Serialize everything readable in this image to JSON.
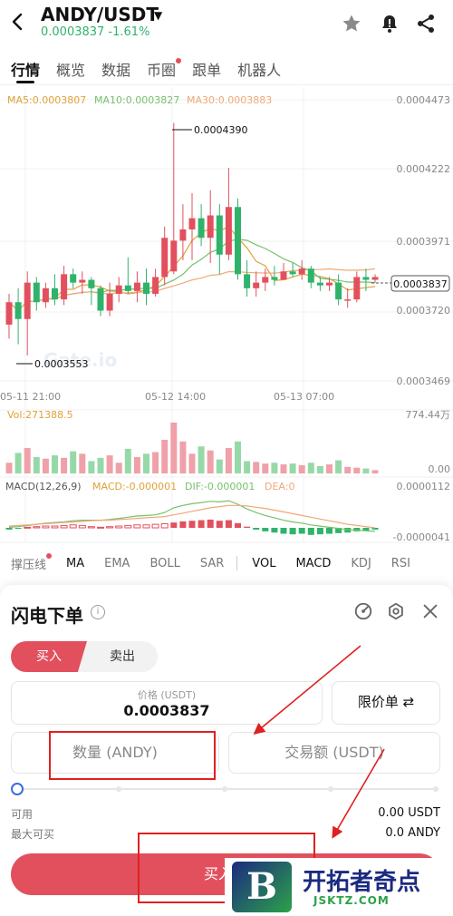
{
  "header": {
    "pair": "ANDY/USDT",
    "price_line": "0.0003837 -1.61%",
    "icons": [
      "back-arrow-icon",
      "caret-down-icon",
      "star-icon",
      "bell-alert-icon",
      "share-icon"
    ]
  },
  "tabs": [
    {
      "label": "行情",
      "active": true
    },
    {
      "label": "概览"
    },
    {
      "label": "数据"
    },
    {
      "label": "币圈",
      "dot": true
    },
    {
      "label": "跟单"
    },
    {
      "label": "机器人"
    }
  ],
  "chart_data": [
    {
      "type": "candlestick",
      "ma_labels": [
        "MA5:0.0003807",
        "MA10:0.0003827",
        "MA30:0.0003883"
      ],
      "ma_colors": [
        "#e0a23a",
        "#76c26b",
        "#f0a878"
      ],
      "y_ticks": [
        "0.0004473",
        "0.0004222",
        "0.0003971",
        "0.0003720",
        "0.0003469"
      ],
      "x_ticks": [
        "05-11 21:00",
        "05-12 14:00",
        "05-13 07:00"
      ],
      "ylim": [
        0.0003469,
        0.0004473
      ],
      "high_label": "0.0004390",
      "low_label": "0.0003553",
      "last_price": "0.0003837",
      "watermark": "Gate.io",
      "candles": [
        [
          0.000367,
          0.000375,
          0.000378,
          0.000362
        ],
        [
          0.000375,
          0.000369,
          0.00038,
          0.00036
        ],
        [
          0.000369,
          0.000382,
          0.000386,
          0.000356
        ],
        [
          0.000382,
          0.000375,
          0.000384,
          0.000372
        ],
        [
          0.000375,
          0.00038,
          0.000382,
          0.000373
        ],
        [
          0.00038,
          0.000376,
          0.000385,
          0.000374
        ],
        [
          0.000376,
          0.000385,
          0.000388,
          0.000374
        ],
        [
          0.000385,
          0.000382,
          0.000387,
          0.00038
        ],
        [
          0.000382,
          0.000383,
          0.000386,
          0.000378
        ],
        [
          0.000383,
          0.00038,
          0.000384,
          0.000374
        ],
        [
          0.00038,
          0.000372,
          0.000381,
          0.00037
        ],
        [
          0.000372,
          0.000378,
          0.000382,
          0.00037
        ],
        [
          0.000378,
          0.000381,
          0.000384,
          0.000375
        ],
        [
          0.000381,
          0.000379,
          0.000391,
          0.000378
        ],
        [
          0.000379,
          0.000382,
          0.000386,
          0.000375
        ],
        [
          0.000382,
          0.000378,
          0.000387,
          0.000374
        ],
        [
          0.000378,
          0.000384,
          0.000387,
          0.000377
        ],
        [
          0.000384,
          0.000398,
          0.000402,
          0.000381
        ],
        [
          0.000386,
          0.000397,
          0.000439,
          0.000385
        ],
        [
          0.000397,
          0.000401,
          0.00041,
          0.00039
        ],
        [
          0.000401,
          0.000405,
          0.000414,
          0.00039
        ],
        [
          0.000405,
          0.000398,
          0.00041,
          0.000395
        ],
        [
          0.000398,
          0.000406,
          0.000415,
          0.000389
        ],
        [
          0.000406,
          0.000392,
          0.00041,
          0.000385
        ],
        [
          0.000392,
          0.000409,
          0.000423,
          0.00039
        ],
        [
          0.000409,
          0.000385,
          0.000412,
          0.000383
        ],
        [
          0.000385,
          0.00038,
          0.00039,
          0.000377
        ],
        [
          0.00038,
          0.000382,
          0.000386,
          0.000377
        ],
        [
          0.000382,
          0.000384,
          0.000387,
          0.000379
        ],
        [
          0.000384,
          0.000383,
          0.000388,
          0.000381
        ],
        [
          0.000383,
          0.000386,
          0.000389,
          0.000383
        ],
        [
          0.000386,
          0.000385,
          0.000389,
          0.000384
        ],
        [
          0.000385,
          0.000387,
          0.00039,
          0.000383
        ],
        [
          0.000387,
          0.000382,
          0.000388,
          0.00038
        ],
        [
          0.000382,
          0.000381,
          0.000384,
          0.000379
        ],
        [
          0.000381,
          0.000382,
          0.000384,
          0.000379
        ],
        [
          0.000382,
          0.000376,
          0.000385,
          0.000374
        ],
        [
          0.000376,
          0.000376,
          0.00038,
          0.000373
        ],
        [
          0.000376,
          0.000384,
          0.000386,
          0.000375
        ],
        [
          0.000384,
          0.000383,
          0.000387,
          0.000379
        ],
        [
          0.000383,
          0.000384,
          0.000385,
          0.000382
        ]
      ]
    },
    {
      "type": "bar",
      "label": "Vol:271388.5",
      "y_ticks": [
        "774.44万",
        "0.00"
      ],
      "ylim": [
        0,
        7744400
      ],
      "values": [
        1300000,
        2500000,
        3100000,
        2000000,
        1800000,
        2200000,
        1900000,
        2700000,
        2400000,
        1500000,
        1900000,
        2200000,
        1300000,
        3000000,
        2000000,
        2400000,
        2600000,
        4100000,
        6200000,
        3900000,
        2400000,
        3300000,
        2800000,
        1700000,
        3100000,
        3900000,
        1500000,
        1400000,
        1200000,
        1300000,
        1100000,
        1200000,
        1000000,
        1300000,
        900000,
        1100000,
        1600000,
        800000,
        700000,
        600000,
        400000
      ]
    },
    {
      "type": "bar",
      "label_parts": [
        "MACD(12,26,9)",
        "MACD:-0.000001",
        "DIF:-0.000001",
        "DEA:0"
      ],
      "y_ticks": [
        "0.0000112",
        "-0.0000041"
      ],
      "ylim": [
        -4.1e-06,
        1.12e-05
      ],
      "values": [
        -0.3,
        -0.1,
        0.1,
        0.2,
        0.3,
        0.3,
        0.4,
        0.5,
        0.4,
        0.2,
        0.1,
        0.2,
        0.3,
        0.4,
        0.5,
        0.5,
        0.6,
        0.7,
        0.9,
        1.1,
        1.2,
        1.3,
        1.4,
        1.2,
        1.3,
        0.8,
        0.2,
        -0.3,
        -0.6,
        -0.8,
        -1.0,
        -1.1,
        -1.0,
        -1.2,
        -1.1,
        -1.0,
        -0.9,
        -0.8,
        -0.6,
        -0.5,
        -0.3
      ],
      "dif": [
        0.1,
        0.2,
        0.4,
        0.6,
        0.8,
        0.9,
        1.0,
        1.2,
        1.3,
        1.3,
        1.3,
        1.4,
        1.6,
        1.8,
        2.0,
        2.1,
        2.2,
        2.6,
        3.4,
        3.8,
        4.1,
        4.3,
        4.5,
        4.4,
        4.6,
        4.0,
        3.2,
        2.6,
        2.1,
        1.7,
        1.3,
        1.0,
        0.8,
        0.5,
        0.3,
        0.1,
        -0.1,
        -0.3,
        -0.4,
        -0.5,
        -0.6
      ],
      "dea": [
        0.3,
        0.4,
        0.5,
        0.6,
        0.7,
        0.8,
        0.9,
        1.0,
        1.1,
        1.2,
        1.3,
        1.3,
        1.4,
        1.5,
        1.6,
        1.7,
        1.8,
        1.9,
        2.2,
        2.5,
        2.8,
        3.1,
        3.4,
        3.6,
        3.8,
        3.8,
        3.7,
        3.5,
        3.3,
        3.0,
        2.7,
        2.4,
        2.1,
        1.8,
        1.5,
        1.2,
        0.9,
        0.6,
        0.4,
        0.2,
        0.0
      ]
    }
  ],
  "indicators": {
    "main": [
      {
        "label": "撑压线",
        "dot": true
      },
      {
        "label": "MA",
        "active": true
      },
      {
        "label": "EMA"
      },
      {
        "label": "BOLL"
      },
      {
        "label": "SAR"
      }
    ],
    "sub": [
      {
        "label": "VOL",
        "active": true
      },
      {
        "label": "MACD",
        "active": true
      },
      {
        "label": "KDJ"
      },
      {
        "label": "RSI"
      }
    ]
  },
  "order_sheet": {
    "title": "闪电下单",
    "buy_label": "买入",
    "sell_label": "卖出",
    "price_label": "价格 (USDT)",
    "price_value": "0.0003837",
    "order_type": "限价单 ⇄",
    "qty_placeholder": "数量 (ANDY)",
    "amount_placeholder": "交易额 (USDT)",
    "slider_pct": 0,
    "available_label": "可用",
    "available_value": "0.00 USDT",
    "maxbuy_label": "最大可买",
    "maxbuy_value": "0.0 ANDY",
    "buy_button": "买入 A"
  },
  "colors": {
    "up": "#2fb36b",
    "down": "#e2505e",
    "accent": "#3a6be0",
    "annotation": "#e02020"
  },
  "watermark": {
    "b": "B",
    "title": "开拓者奇点",
    "url": "JSKTZ.COM"
  }
}
